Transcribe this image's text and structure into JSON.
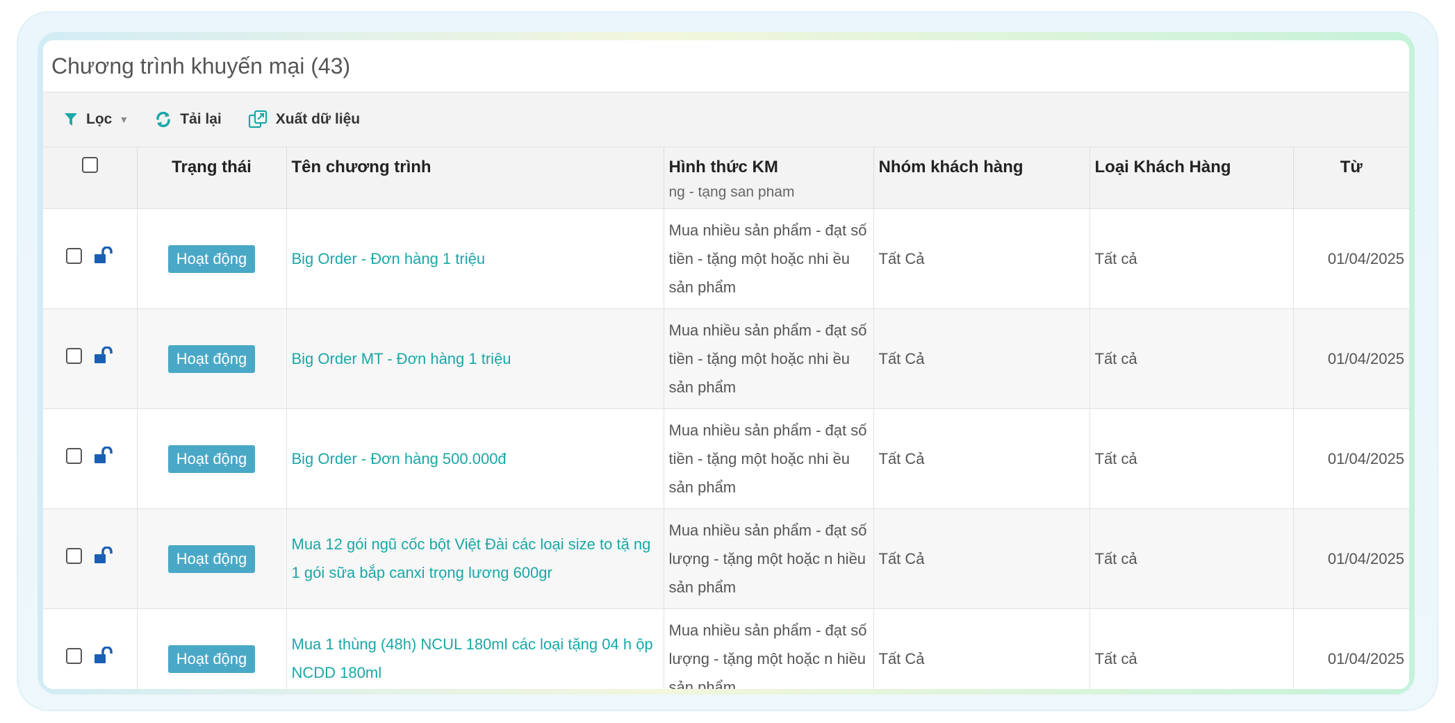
{
  "panel": {
    "title": "Chương trình khuyến mại (43)"
  },
  "toolbar": {
    "filter_label": "Lọc",
    "reload_label": "Tải lại",
    "export_label": "Xuất dữ liệu"
  },
  "colors": {
    "accent": "#1aa7a7",
    "badge": "#4aa8c7",
    "filter_icon": "#1aa7a7",
    "lock_icon": "#1a5fb4"
  },
  "icons": {
    "filter": "filter-icon",
    "reload": "refresh-icon",
    "export": "export-icon",
    "lock": "unlock-icon",
    "caret": "caret-down-icon"
  },
  "table": {
    "headers": {
      "status": "Trạng thái",
      "name": "Tên chương trình",
      "type": "Hình thức KM",
      "group": "Nhóm khách hàng",
      "ctype": "Loại Khách Hàng",
      "from": "Từ"
    },
    "overflow_text": "ng - tặng sản phẩm",
    "rows": [
      {
        "status": "Hoạt động",
        "name": "Big Order - Đơn hàng 1 triệu",
        "type": "Mua nhiều sản phẩm - đạt số tiền - tặng một hoặc nhi ều sản phẩm",
        "group": "Tất Cả",
        "ctype": "Tất cả",
        "from": "01/04/2025"
      },
      {
        "status": "Hoạt động",
        "name": "Big Order MT - Đơn hàng 1 triệu",
        "type": "Mua nhiều sản phẩm - đạt số tiền - tặng một hoặc nhi ều sản phẩm",
        "group": "Tất Cả",
        "ctype": "Tất cả",
        "from": "01/04/2025"
      },
      {
        "status": "Hoạt động",
        "name": "Big Order - Đơn hàng 500.000đ",
        "type": "Mua nhiều sản phẩm - đạt số tiền - tặng một hoặc nhi ều sản phẩm",
        "group": "Tất Cả",
        "ctype": "Tất cả",
        "from": "01/04/2025"
      },
      {
        "status": "Hoạt động",
        "name": "Mua 12 gói ngũ cốc bột Việt Đài các loại size to tặ ng 1 gói sữa bắp canxi trọng lương 600gr",
        "type": "Mua nhiều sản phẩm - đạt số lượng - tặng một hoặc n hiều sản phẩm",
        "group": "Tất Cả",
        "ctype": "Tất cả",
        "from": "01/04/2025"
      },
      {
        "status": "Hoạt động",
        "name": "Mua 1 thùng (48h) NCUL 180ml các loại tặng 04 h ộp NCDD 180ml",
        "type": "Mua nhiều sản phẩm - đạt số lượng - tặng một hoặc n hiều sản phẩm",
        "group": "Tất Cả",
        "ctype": "Tất cả",
        "from": "01/04/2025"
      }
    ]
  }
}
